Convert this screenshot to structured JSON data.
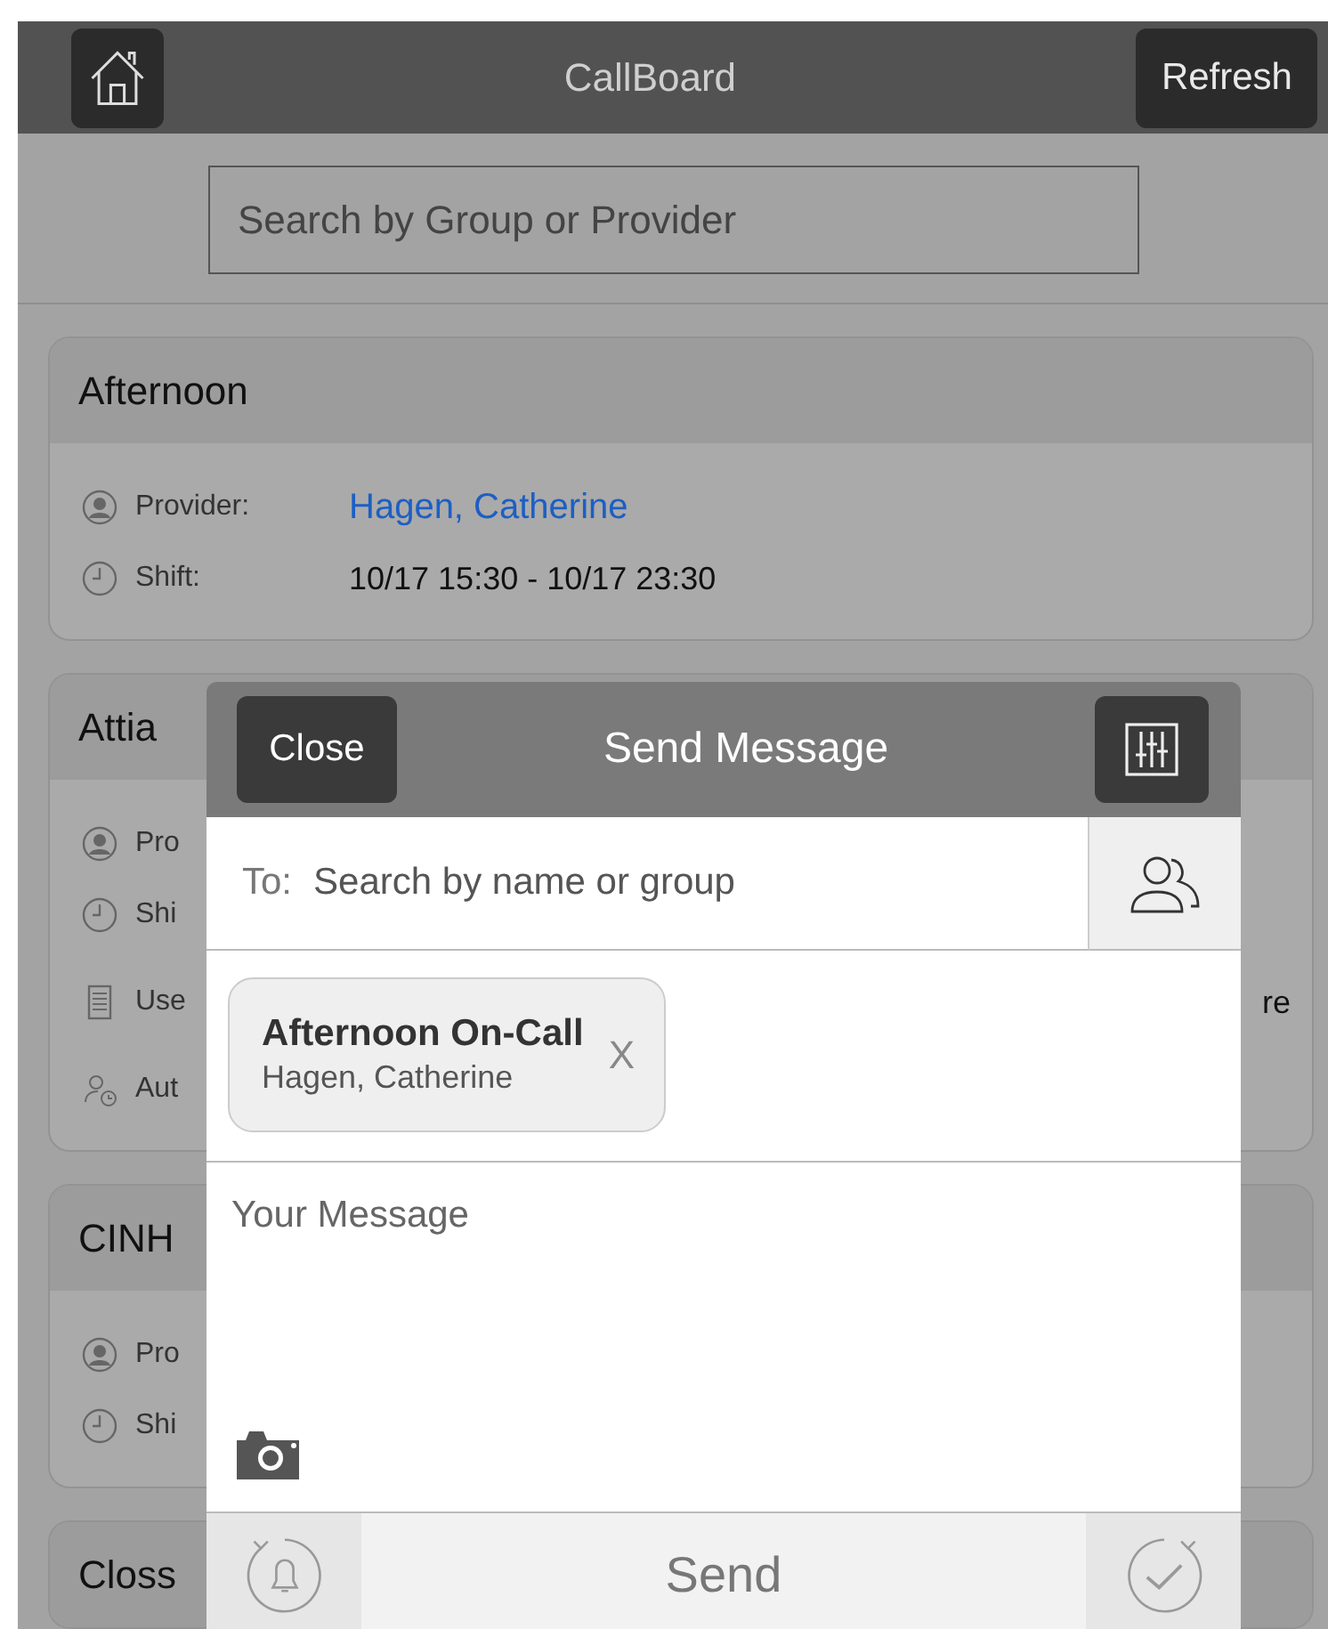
{
  "header": {
    "title": "CallBoard",
    "refresh_button": "Refresh"
  },
  "search": {
    "placeholder": "Search by Group or Provider"
  },
  "cards": [
    {
      "title": "Afternoon",
      "rows": [
        {
          "kind": "provider",
          "label": "Provider:",
          "value": "Hagen, Catherine"
        },
        {
          "kind": "shift",
          "label": "Shift:",
          "value": "10/17 15:30 - 10/17 23:30"
        }
      ]
    },
    {
      "title": "Attia",
      "rows": [
        {
          "kind": "provider",
          "label": "Pro"
        },
        {
          "kind": "shift",
          "label": "Shi"
        },
        {
          "kind": "notes",
          "label": "Use",
          "value": "re"
        },
        {
          "kind": "auto",
          "label": "Aut"
        }
      ]
    },
    {
      "title": "CINH",
      "rows": [
        {
          "kind": "provider",
          "label": "Pro"
        },
        {
          "kind": "shift",
          "label": "Shi"
        }
      ]
    },
    {
      "title": "Closs"
    }
  ],
  "dialog": {
    "title": "Send Message",
    "close_button": "Close",
    "to_label": "To:",
    "to_placeholder": "Search by name or group",
    "recipients": [
      {
        "group": "Afternoon On-Call",
        "name": "Hagen, Catherine",
        "remove": "X"
      }
    ],
    "message_placeholder": "Your Message",
    "send_button": "Send"
  }
}
